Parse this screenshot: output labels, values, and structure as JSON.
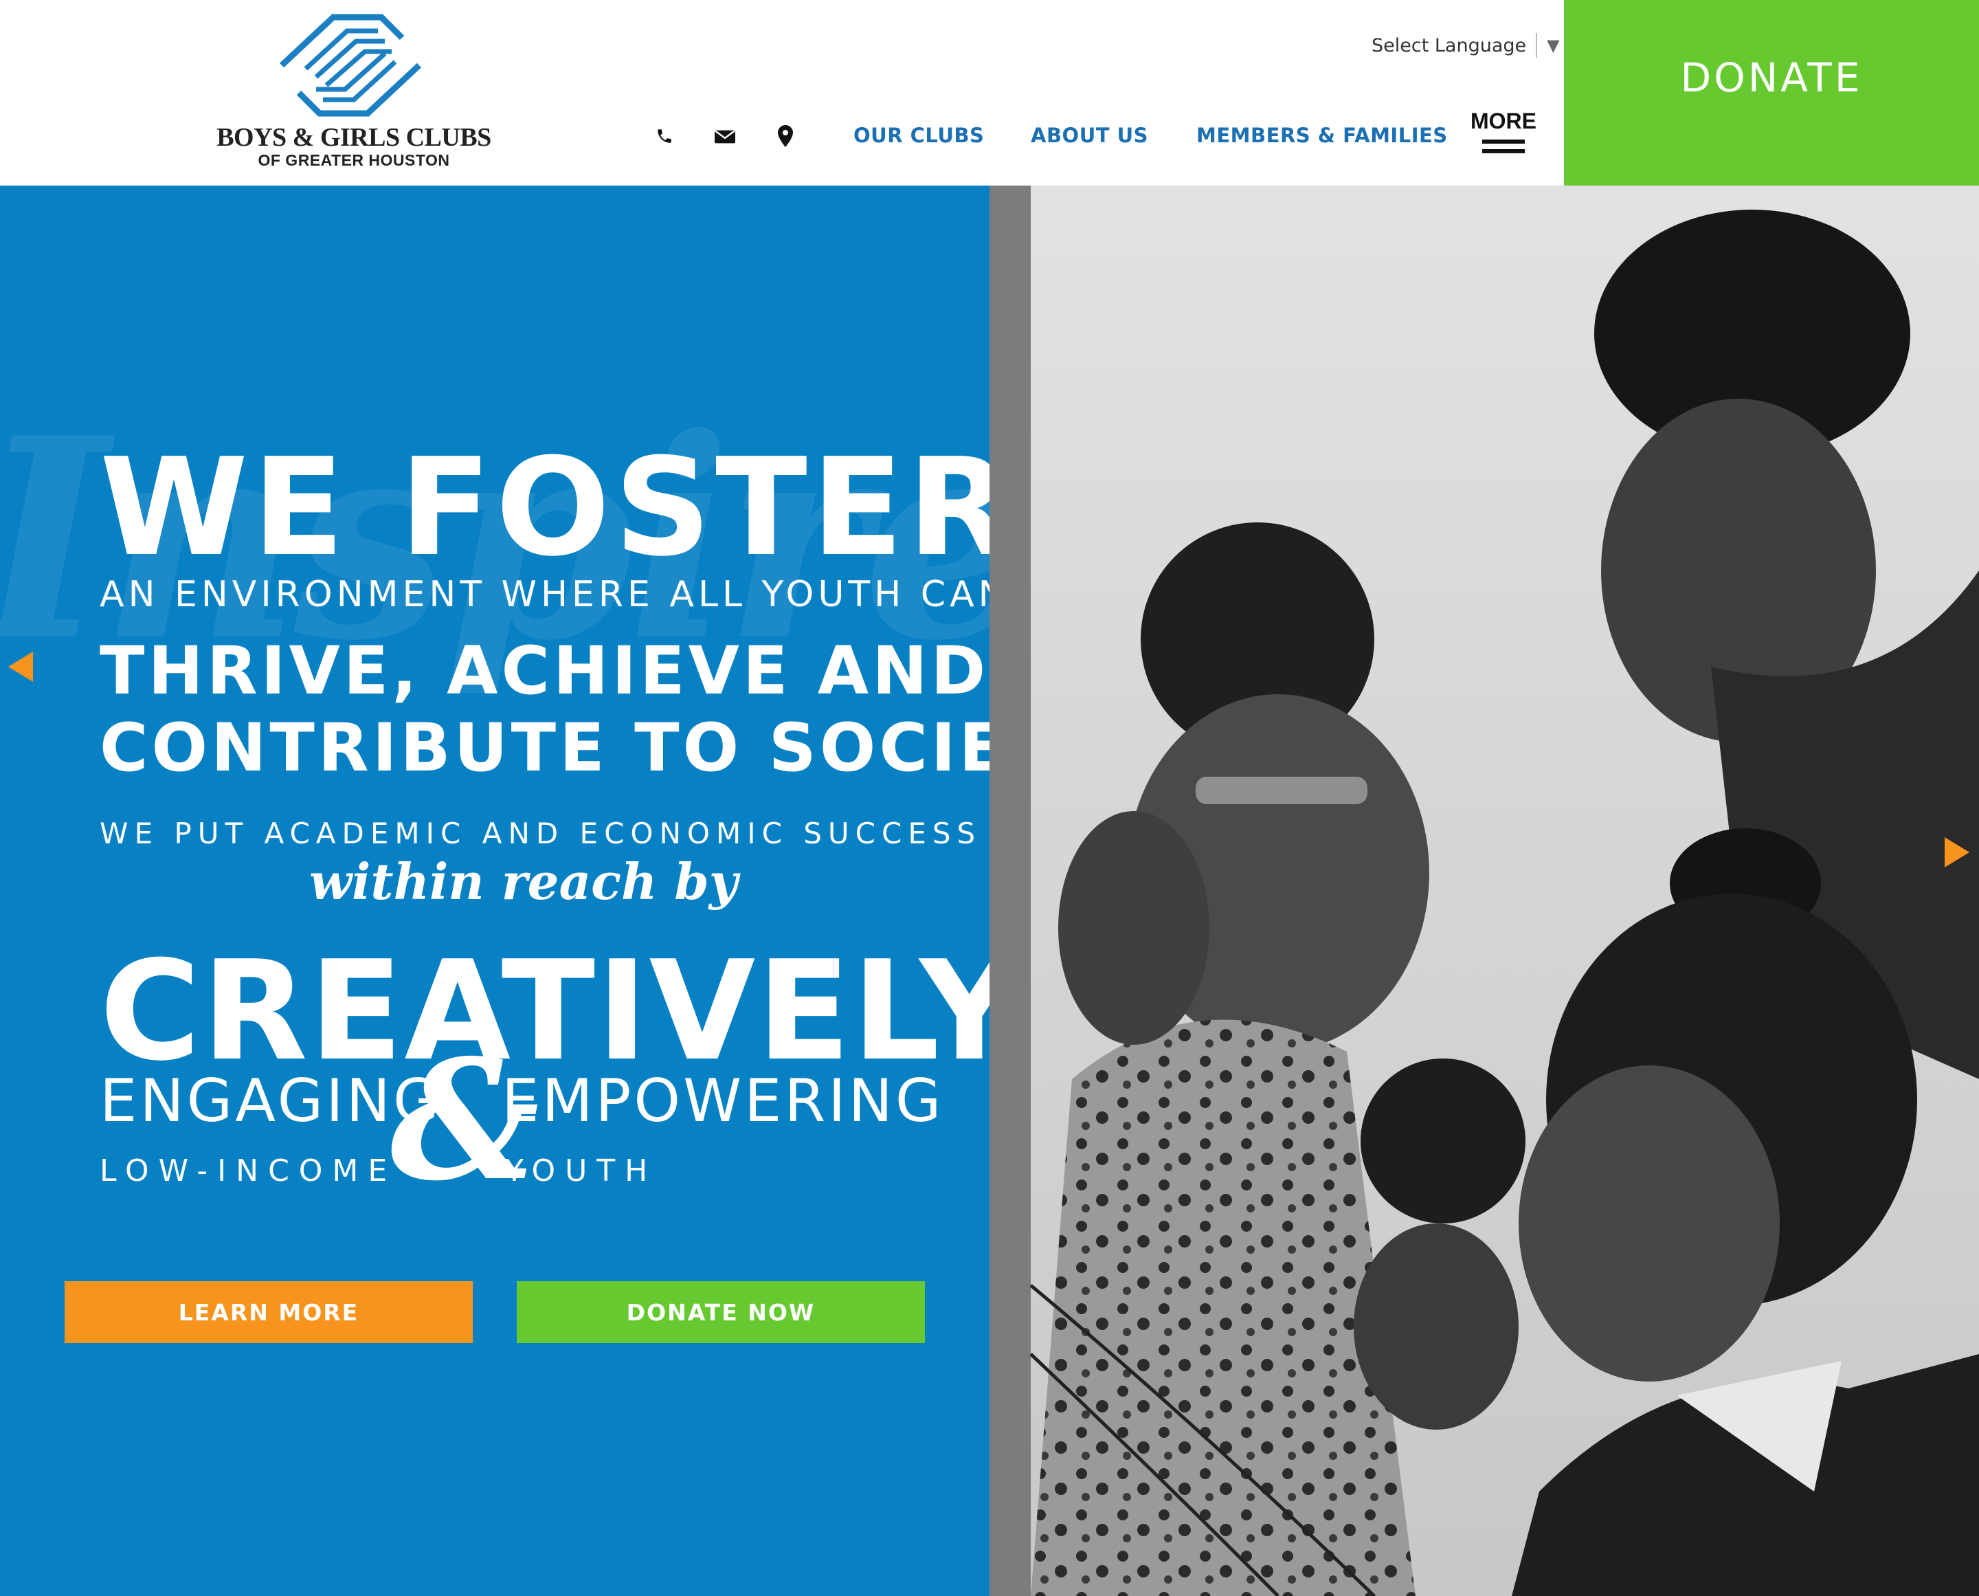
{
  "header": {
    "logo": {
      "title": "BOYS & GIRLS CLUBS",
      "subtitle": "OF GREATER HOUSTON",
      "color": "#1b7fc4"
    },
    "language_selector": {
      "label": "Select Language",
      "arrow": "▼"
    },
    "contact_icons": [
      "phone-icon",
      "envelope-icon",
      "map-pin-icon"
    ],
    "nav": [
      {
        "label": "OUR CLUBS"
      },
      {
        "label": "ABOUT US"
      },
      {
        "label": "MEMBERS & FAMILIES"
      }
    ],
    "more_label": "MORE",
    "donate_label": "DONATE",
    "donate_color": "#66c92f",
    "nav_color": "#1b6fb3"
  },
  "hero": {
    "background_color": "#0781c4",
    "watermark": "Inspire",
    "lines": {
      "we_foster": "WE FOSTER",
      "environment": "AN ENVIRONMENT WHERE ALL YOUTH CAN",
      "thrive": "THRIVE, ACHIEVE AND",
      "contribute": "CONTRIBUTE TO SOCIETY.",
      "put_success": "WE PUT ACADEMIC AND ECONOMIC SUCCESS",
      "within_reach": "within reach by",
      "creatively": "CREATIVELY",
      "engaging": "ENGAGING",
      "empowering": "EMPOWERING",
      "ampersand": "&",
      "low_income": "LOW-INCOME",
      "youth": "YOUTH"
    },
    "buttons": {
      "learn_more": "LEARN MORE",
      "donate_now": "DONATE NOW"
    },
    "button_colors": {
      "learn_more": "#f7941d",
      "donate_now": "#66c92f"
    },
    "carousel_arrow_color": "#f7941d"
  },
  "photo": {
    "alt": "Black and white photo of three girls at a computer"
  }
}
